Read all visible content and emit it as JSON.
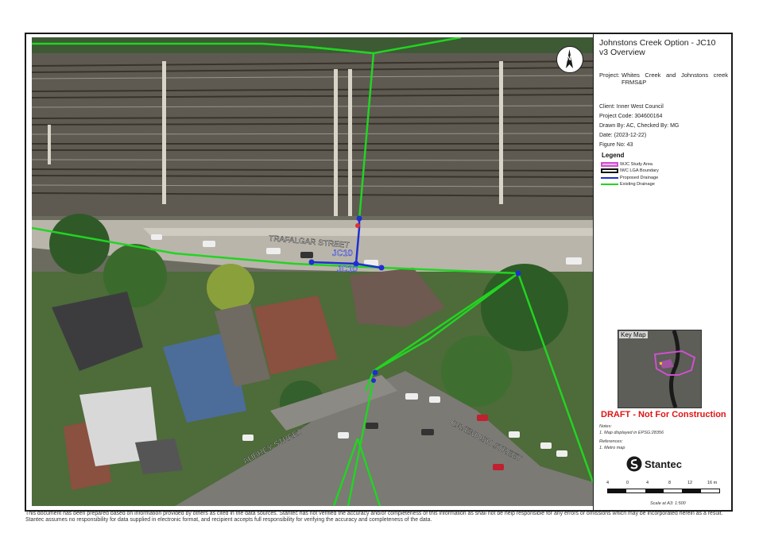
{
  "title": "Johnstons Creek Option - JC10 v3 Overview",
  "project_label": "Project:",
  "project": "Whites Creek and Johnstons creek FRMS&P",
  "client": "Client: Inner West Council",
  "project_code": "Project Code: 304600164",
  "drawn_by": "Drawn By: AC, Checked By: MG",
  "date": "Date: (2023-12-22)",
  "figure_no": "Figure No: 43",
  "legend": {
    "title": "Legend",
    "items": [
      {
        "label": "WJC Study Area",
        "color": "#d04fd0"
      },
      {
        "label": "IWC LGA Boundary",
        "color": "#111111"
      },
      {
        "label": "Proposed Drainage",
        "color": "#1f2fd0"
      },
      {
        "label": "Existing Drainage",
        "color": "#22d422"
      }
    ]
  },
  "key_map_label": "Key Map",
  "draft": "DRAFT - Not For Construction",
  "notes_title": "Notes:",
  "notes_1": "1. Map displayed in EPSG:28356",
  "references_title": "References:",
  "references_1": "1. Metro map",
  "company": "Stantec",
  "scale_ticks": [
    "4",
    "0",
    "4",
    "8",
    "12",
    "16 m"
  ],
  "scale_text": "Scale at A3: 1:500",
  "north": "N",
  "map_labels": {
    "trafalgar": "TRAFALGAR STREET",
    "aubrey": "AUBREY STREET",
    "cavendish": "CAVENDISH STREET",
    "jc10_a": "JC10",
    "jc10_b": "JC10"
  },
  "disclaimer": "This document has been prepared based on information provided by others as cited in the data sources. Stantec has not verified the accuracy and/or completeness of this information as shall not be help responsible for any errors or omissions which may be incorporated herein as a result. Stantec assumes no responsibility for data supplied in electronic format, and recipient accepts full responsibility for verifying the accuracy and completeness of the data."
}
